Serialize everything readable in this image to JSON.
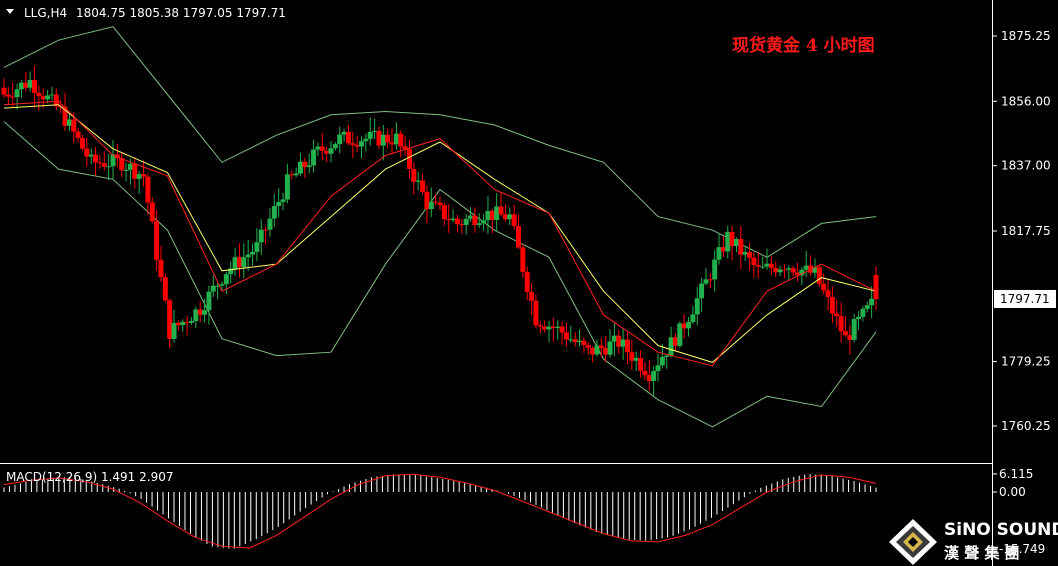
{
  "header": {
    "symbol": "LLG,H4",
    "ohlc": "1804.75 1805.38 1797.05 1797.71",
    "chart_title": "现货黄金 4 小时图"
  },
  "price_axis": {
    "ticks": [
      "1875.25",
      "1856.00",
      "1837.00",
      "1817.75",
      "1779.25",
      "1760.25"
    ],
    "current_price": "1797.71"
  },
  "macd": {
    "label": "MACD(12,26,9) 1.491 2.907",
    "ticks": [
      "6.115",
      "0.00",
      "-15.749"
    ]
  },
  "brand": {
    "name": "SiNO SOUND",
    "subtitle": "漢 聲 集 團"
  },
  "colors": {
    "background": "#000000",
    "bull": "#22b14c",
    "bear": "#ff0000",
    "ma_fast": "#ff2020",
    "ma_slow": "#ffff66",
    "bollinger": "#7fbf7f",
    "macd_hist": "#ffffff",
    "macd_signal": "#ff2020",
    "axis": "#ffffff"
  },
  "chart_data": [
    {
      "type": "candlestick",
      "title": "",
      "ylim": [
        1750,
        1884
      ],
      "y_ticks": [
        1760.25,
        1779.25,
        1797.71,
        1817.75,
        1837.0,
        1856.0,
        1875.25
      ],
      "bars_per_segment": [
        6,
        7,
        7,
        7,
        5,
        6,
        7,
        6,
        7,
        7,
        7,
        5,
        7,
        6,
        7,
        7,
        6,
        6,
        6,
        6
      ],
      "close_path": [
        1858,
        1862,
        1853,
        1838,
        1838,
        1834,
        1788,
        1795,
        1806,
        1813,
        1832,
        1841,
        1845,
        1845,
        1845,
        1826,
        1820,
        1823,
        1822,
        1792,
        1788,
        1782,
        1785,
        1776,
        1788,
        1800,
        1816,
        1806,
        1808,
        1805,
        1786,
        1797.71
      ],
      "bollinger_upper": [
        1866,
        1874,
        1878,
        1858,
        1838,
        1846,
        1852,
        1853,
        1852,
        1849,
        1843,
        1838,
        1822,
        1818,
        1810,
        1820,
        1822
      ],
      "bollinger_lower": [
        1850,
        1836,
        1833,
        1818,
        1786,
        1781,
        1782,
        1808,
        1830,
        1818,
        1810,
        1780,
        1768,
        1760,
        1769,
        1766,
        1788
      ],
      "ma_fast": [
        1855,
        1856,
        1840,
        1834,
        1800,
        1808,
        1828,
        1840,
        1845,
        1830,
        1823,
        1793,
        1782,
        1778,
        1800,
        1808,
        1800
      ],
      "ma_slow": [
        1854,
        1855,
        1842,
        1835,
        1806,
        1808,
        1822,
        1836,
        1844,
        1833,
        1823,
        1800,
        1784,
        1779,
        1793,
        1804,
        1800
      ]
    },
    {
      "type": "bar",
      "title": "",
      "series": [
        {
          "name": "",
          "values": [
            1.5,
            3.5,
            4.8,
            5.2,
            3.2,
            1.2,
            -2.0,
            -6.5,
            -11.0,
            -15.0,
            -15.749,
            -13.0,
            -9.5,
            -5.0,
            -1.0,
            2.5,
            5.0,
            6.0,
            5.8,
            4.6,
            3.2,
            1.5,
            -0.5,
            -3.0,
            -6.0,
            -9.0,
            -11.5,
            -13.0,
            -13.5,
            -12.5,
            -10.0,
            -6.5,
            -2.5,
            1.5,
            4.5,
            6.115,
            5.5,
            3.8,
            1.491
          ]
        },
        {
          "name": "",
          "values": [
            2.5,
            4.0,
            4.8,
            3.5,
            1.0,
            -3.0,
            -8.0,
            -12.5,
            -15.0,
            -15.5,
            -12.0,
            -7.0,
            -2.0,
            2.5,
            5.5,
            6.0,
            5.0,
            3.0,
            0.5,
            -2.5,
            -5.5,
            -8.5,
            -11.5,
            -13.5,
            -13.8,
            -12.0,
            -9.0,
            -4.5,
            0.0,
            3.5,
            5.8,
            5.0,
            2.907
          ]
        }
      ],
      "ylim": [
        -15.749,
        6.115
      ],
      "y_ticks": [
        6.115,
        0.0,
        -15.749
      ]
    }
  ]
}
